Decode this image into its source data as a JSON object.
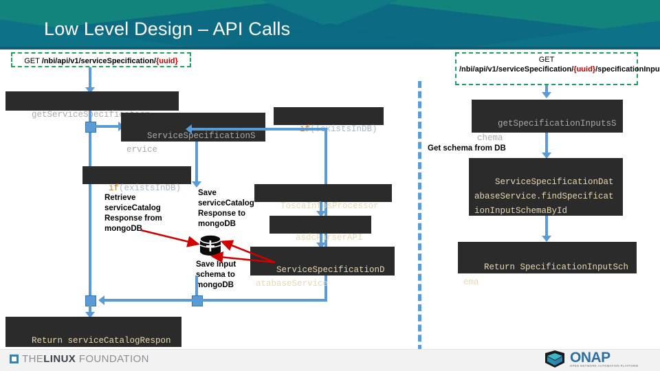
{
  "header": {
    "title": "Low Level Design – API Calls",
    "bg_color": "#0c6b82",
    "accent_color": "#13897f"
  },
  "requests": [
    {
      "id": "get-service-specification",
      "verb": "GET ",
      "path": "/nbi/api/v1/serviceSpecification/",
      "uuid": "{uuid}",
      "suffix": ""
    },
    {
      "id": "get-specification-input-schema",
      "verb": "GET",
      "path": "/nbi/api/v1/serviceSpecification/",
      "uuid": "{uuid}",
      "suffix": "/specificationInputSchema"
    }
  ],
  "left_flow": {
    "entry_box": "getServiceSpecification",
    "service_box": "ServiceSpecificationService",
    "if_exists": {
      "keyword": "if",
      "condition": "(existsInDB)"
    },
    "if_not_exists": {
      "keyword": "if",
      "condition": "(!existsInDB)"
    },
    "retrieve_note": "Retrieve serviceCatalog Response from mongoDB",
    "save_note": "Save serviceCatalog Response to mongoDB",
    "save_input_note": "Save Input schema to mongoDB",
    "tosca_box": "ToscaInfosProcessor",
    "asdc_box": "asdcParserAPI",
    "db_service_box": "ServiceSpecificationDatabaseService",
    "return_box": "Return serviceCatalogResponse",
    "db_icon": "database-cylinder-icon"
  },
  "right_flow": {
    "entry_box": "getSpecificationInputsSchema",
    "get_schema_note": "Get schema from DB",
    "find_box": "ServiceSpecificationDatabaseService.findSpecificationInputSchemaById",
    "return_box": "Return SpecificationInputSchema"
  },
  "footer": {
    "linux_foundation": {
      "the": "THE",
      "linux": "LINUX",
      "foundation": "FOUNDATION"
    },
    "onap": {
      "name": "ONAP",
      "tagline": "OPEN NETWORK AUTOMATION PLATFORM"
    }
  },
  "colors": {
    "box_bg": "#2b2b2b",
    "code_text": "#e8d8b0",
    "gray_text": "#a9a9a9",
    "keyword": "#cc7832",
    "connector": "#5b9bd5",
    "dashed_green": "#1aa35a",
    "uuid_red": "#c00000",
    "red_arrow": "#d00000"
  }
}
